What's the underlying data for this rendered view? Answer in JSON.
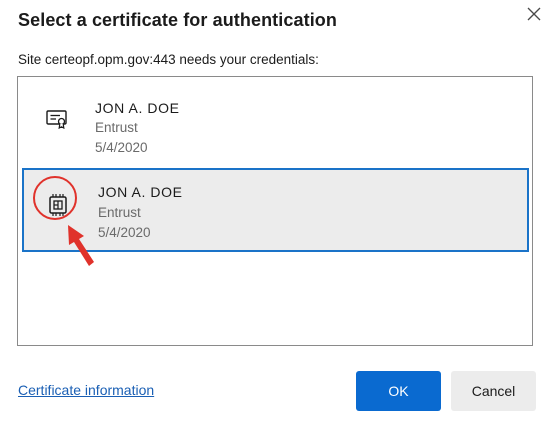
{
  "dialog": {
    "title": "Select a certificate for authentication",
    "subtitle": "Site certeopf.opm.gov:443 needs your credentials:",
    "close_icon": "close-icon"
  },
  "certificates": [
    {
      "name": "JON A. DOE",
      "issuer": "Entrust",
      "date": "5/4/2020",
      "icon": "certificate-icon",
      "selected": false
    },
    {
      "name": "JON A. DOE",
      "issuer": "Entrust",
      "date": "5/4/2020",
      "icon": "smart-card-chip-icon",
      "selected": true
    }
  ],
  "footer": {
    "cert_info_link": "Certificate information",
    "ok_label": "OK",
    "cancel_label": "Cancel"
  },
  "colors": {
    "accent": "#0a6ad0",
    "selection_border": "#1a73c8",
    "annotation": "#e0322b",
    "link": "#1a5fb4"
  }
}
